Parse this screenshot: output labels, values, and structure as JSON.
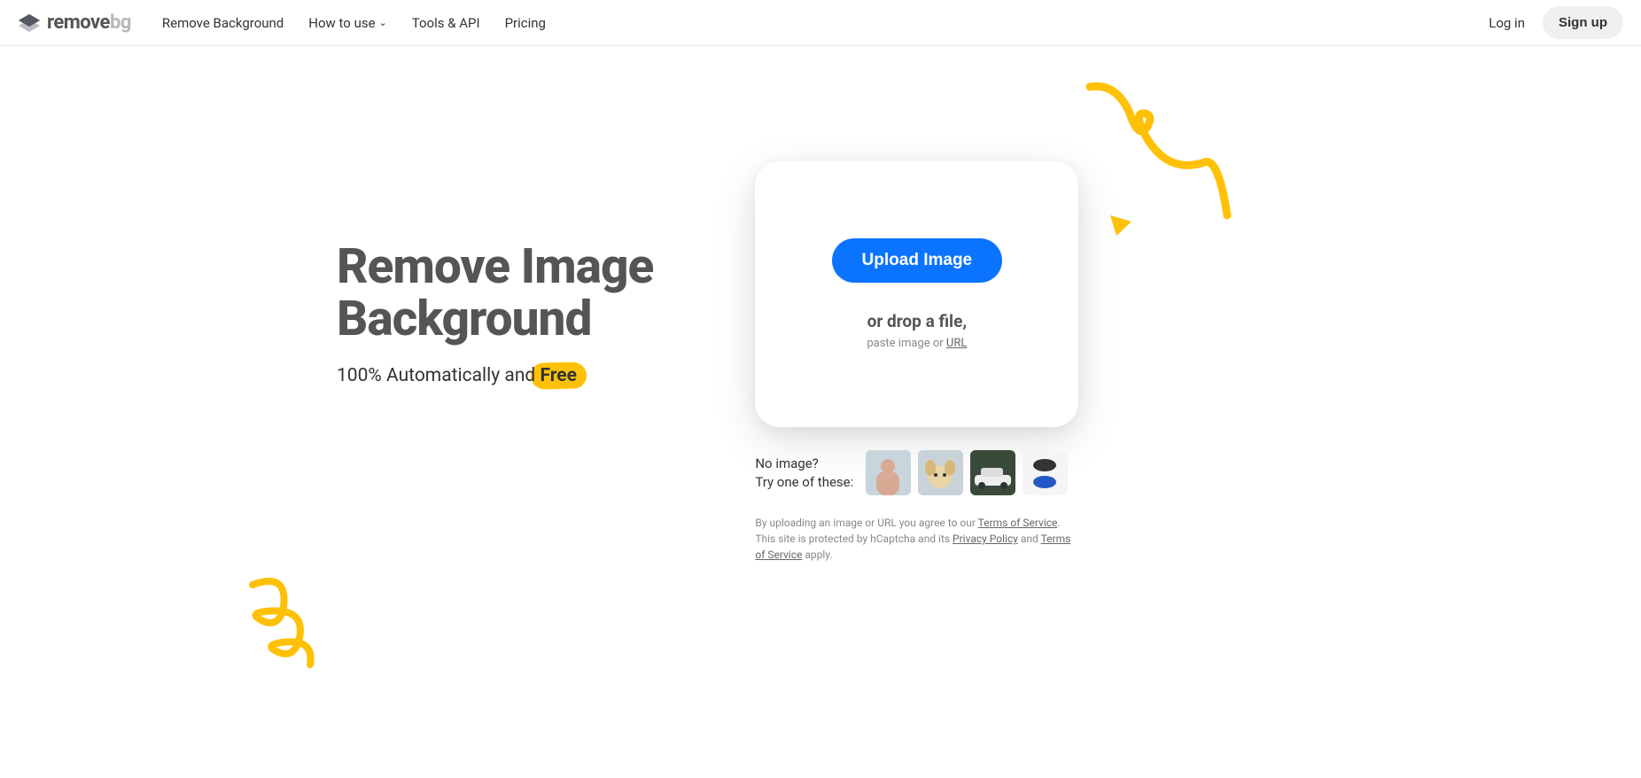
{
  "logo": {
    "remove": "remove",
    "bg": "bg"
  },
  "nav": {
    "remove_bg": "Remove Background",
    "how_to": "How to use",
    "tools": "Tools & API",
    "pricing": "Pricing"
  },
  "auth": {
    "login": "Log in",
    "signup": "Sign up"
  },
  "hero": {
    "title_line1": "Remove Image",
    "title_line2": "Background",
    "subtitle_prefix": "100% Automatically and ",
    "free": "Free"
  },
  "upload": {
    "button": "Upload Image",
    "drop": "or drop a file,",
    "paste_prefix": "paste image or ",
    "url": "URL"
  },
  "examples": {
    "line1": "No image?",
    "line2": "Try one of these:"
  },
  "legal": {
    "part1": "By uploading an image or URL you agree to our ",
    "tos1": "Terms of Service",
    "part2": ". This site is protected by hCaptcha and its ",
    "privacy": "Privacy Policy",
    "part3": " and ",
    "tos2": "Terms of Service",
    "part4": " apply."
  }
}
